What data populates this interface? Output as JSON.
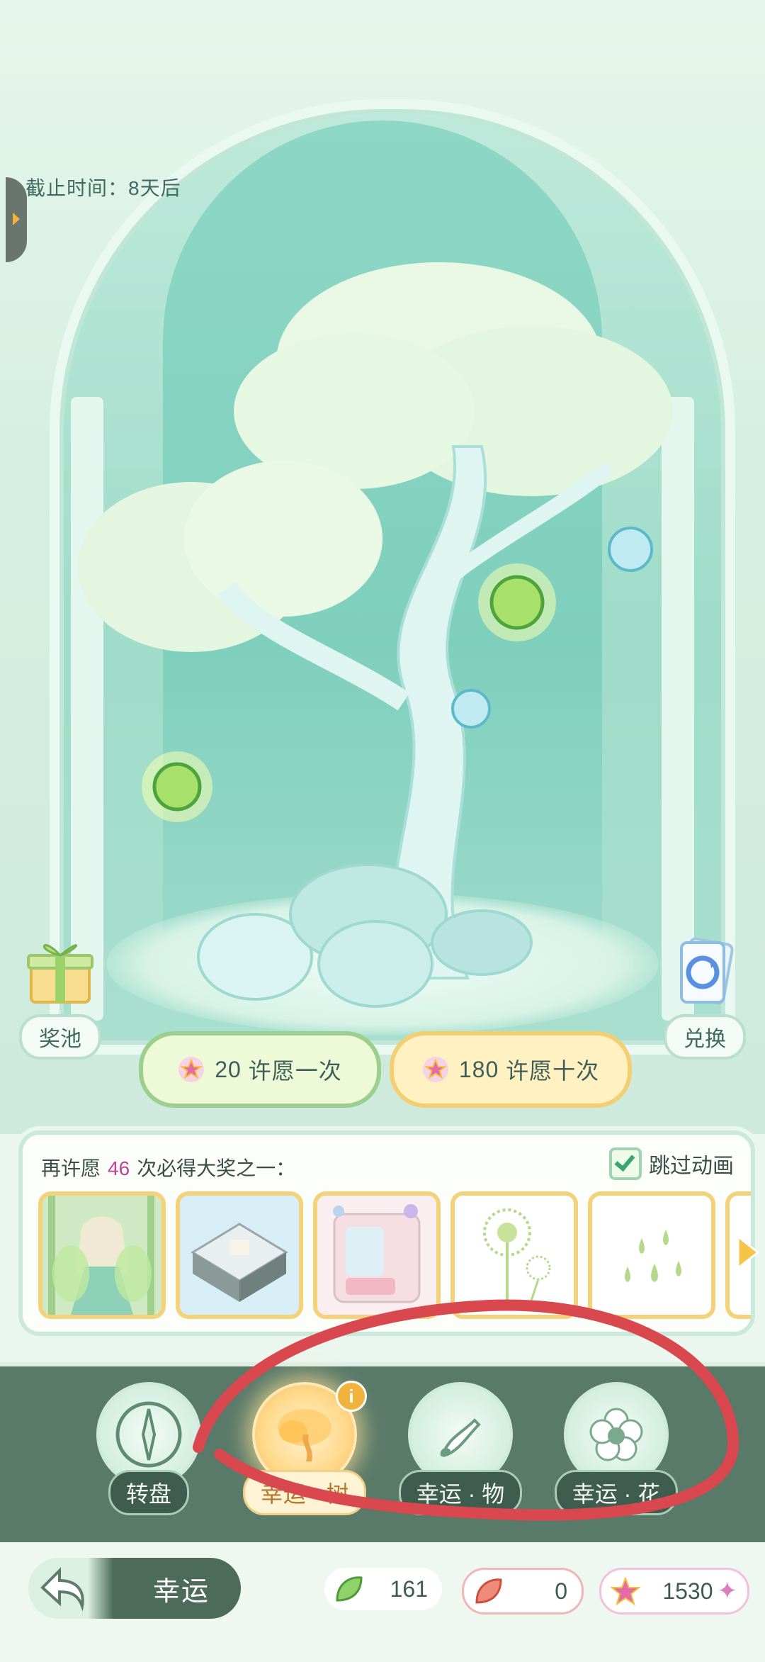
{
  "deadline": "截止时间：8天后",
  "corner": {
    "pool_label": "奖池",
    "exchange_label": "兑换"
  },
  "wish": {
    "once_cost": "20",
    "once_label": "许愿一次",
    "ten_cost": "180",
    "ten_label": "许愿十次"
  },
  "panel": {
    "prefix": "再许愿",
    "count": "46",
    "suffix": "次必得大奖之一：",
    "skip_label": "跳过动画",
    "prizes": [
      "fairy-outfit",
      "tiled-room",
      "pink-room",
      "dandelion",
      "water-drops"
    ]
  },
  "tabs": [
    {
      "name": "转盘",
      "sub": ""
    },
    {
      "name": "幸运 · 树",
      "sub": ""
    },
    {
      "name": "幸运 · 物",
      "sub": ""
    },
    {
      "name": "幸运 · 花",
      "sub": ""
    }
  ],
  "footer": {
    "title": "幸运",
    "leaf": "161",
    "feather": "0",
    "star": "1530"
  },
  "colors": {
    "accent_red": "#d8484e",
    "tab_bg": "#5a7a69",
    "gold": "#f4d27c"
  }
}
